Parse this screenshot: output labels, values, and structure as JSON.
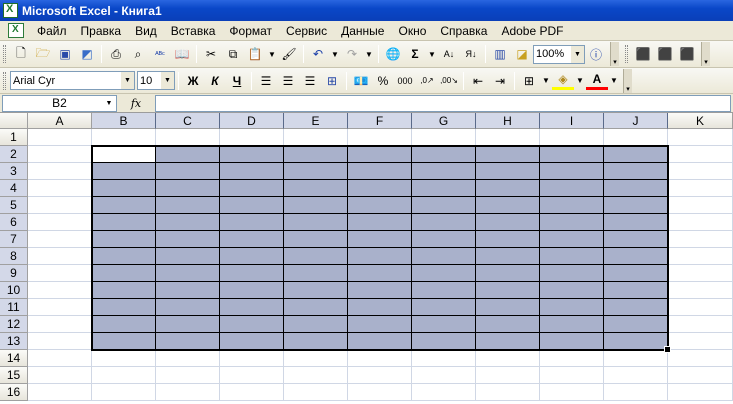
{
  "window": {
    "title": "Microsoft Excel - Книга1"
  },
  "menu": [
    "Файл",
    "Правка",
    "Вид",
    "Вставка",
    "Формат",
    "Сервис",
    "Данные",
    "Окно",
    "Справка",
    "Adobe PDF"
  ],
  "toolbar": {
    "zoom": "100%",
    "font_name": "Arial Cyr",
    "font_size": "10",
    "bold_label": "Ж",
    "italic_label": "К",
    "underline_label": "Ч",
    "percent_label": "%",
    "thousands_label": "000",
    "autosum_label": "Σ",
    "icons": [
      "new-icon",
      "open-icon",
      "save-icon",
      "permission-icon",
      "print-icon",
      "print-preview-icon",
      "spelling-icon",
      "research-icon",
      "cut-icon",
      "copy-icon",
      "paste-icon",
      "format-painter-icon",
      "undo-icon",
      "redo-icon",
      "hyperlink-icon",
      "autosum-icon",
      "sort-asc-icon",
      "sort-desc-icon",
      "chart-wizard-icon",
      "drawing-icon",
      "help-icon"
    ]
  },
  "formula_bar": {
    "name_box": "B2",
    "fx_label": "fx",
    "content": ""
  },
  "grid": {
    "columns": [
      "A",
      "B",
      "C",
      "D",
      "E",
      "F",
      "G",
      "H",
      "I",
      "J",
      "K"
    ],
    "rows": [
      "1",
      "2",
      "3",
      "4",
      "5",
      "6",
      "7",
      "8",
      "9",
      "10",
      "11",
      "12",
      "13",
      "14",
      "15",
      "16"
    ],
    "selection": "B2:J13",
    "active_cell": "B2",
    "colors": {
      "selected_fill": "#a9b1cb",
      "header_selected": "#d3d8e8",
      "gridline": "#d0d7e5"
    }
  }
}
